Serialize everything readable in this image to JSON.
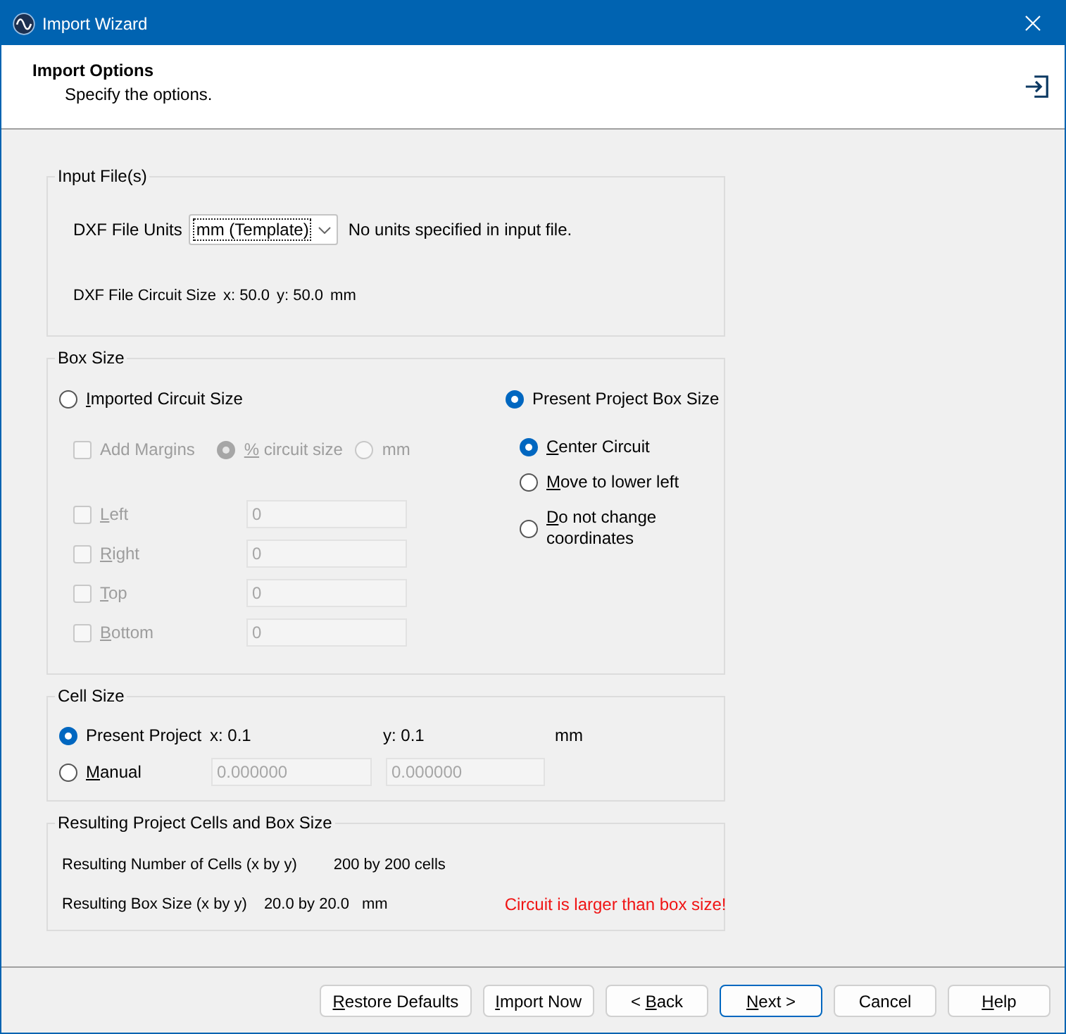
{
  "window": {
    "title": "Import Wizard"
  },
  "header": {
    "title": "Import Options",
    "subtitle": "Specify the options."
  },
  "input_files": {
    "legend": "Input File(s)",
    "units_label": "DXF File Units",
    "units_value": "mm (Template)",
    "units_note": "No units specified in input file.",
    "circuit_size": {
      "label": "DXF File Circuit Size",
      "x": "x: 50.0",
      "y": "y: 50.0",
      "unit": "mm"
    }
  },
  "box_size": {
    "legend": "Box Size",
    "modes": [
      {
        "label": "Imported Circuit Size",
        "selected": false,
        "underlined": true
      },
      {
        "label": "Present Project Box Size",
        "selected": true,
        "underlined": false
      }
    ],
    "add_margins": {
      "label": "Add Margins",
      "checked": false,
      "disabled": true,
      "underlined": false
    },
    "margin_units": [
      {
        "label": "% circuit size",
        "selected": true,
        "disabled": true,
        "underlined": true
      },
      {
        "label": "mm",
        "selected": false,
        "disabled": true,
        "underlined": false
      }
    ],
    "margins": [
      {
        "label": "Left",
        "checked": false,
        "disabled": true,
        "underlined": true,
        "value": "0"
      },
      {
        "label": "Right",
        "checked": false,
        "disabled": true,
        "underlined": true,
        "value": "0"
      },
      {
        "label": "Top",
        "checked": false,
        "disabled": true,
        "underlined": true,
        "value": "0"
      },
      {
        "label": "Bottom",
        "checked": false,
        "disabled": true,
        "underlined": true,
        "value": "0"
      }
    ],
    "placement": [
      {
        "label": "Center Circuit",
        "selected": true,
        "underlined": true
      },
      {
        "label": "Move to lower left",
        "selected": false,
        "underlined": true
      },
      {
        "label": "Do not change coordinates",
        "selected": false,
        "underlined": true
      }
    ]
  },
  "cell_size": {
    "legend": "Cell Size",
    "options": [
      {
        "kind": "readout",
        "label": "Present Project",
        "selected": true,
        "underlined": false,
        "x": "x: 0.1",
        "y": "y: 0.1",
        "unit": "mm"
      },
      {
        "kind": "fields",
        "label": "Manual",
        "selected": false,
        "underlined": true,
        "fields": [
          {
            "value": "0.000000",
            "disabled": true
          },
          {
            "value": "0.000000",
            "disabled": true
          }
        ]
      }
    ]
  },
  "results": {
    "legend": "Resulting Project Cells and Box Size",
    "rows": [
      {
        "label": "Resulting Number of Cells (x by y)",
        "value": "200 by 200 cells"
      },
      {
        "label": "Resulting Box Size (x by y)",
        "value": "20.0 by 20.0",
        "unit": "mm",
        "warning": "Circuit is larger than box size!"
      }
    ]
  },
  "buttons": [
    {
      "label": "Restore Defaults",
      "underlined": true,
      "default": false
    },
    {
      "label": "Import Now",
      "underlined": true,
      "default": false
    },
    {
      "prefix": "<",
      "label": "Back",
      "underlined": true,
      "default": false
    },
    {
      "label": "Next",
      "suffix": ">",
      "underlined": true,
      "default": true
    },
    {
      "label": "Cancel",
      "underlined": false,
      "default": false
    },
    {
      "label": "Help",
      "underlined": true,
      "default": false
    }
  ]
}
